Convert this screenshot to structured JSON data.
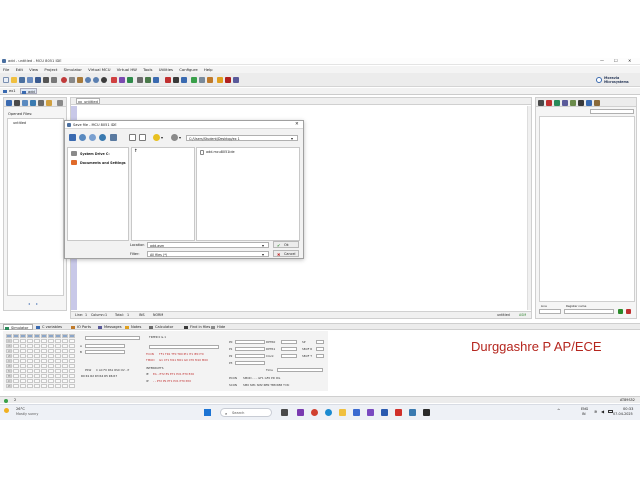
{
  "window": {
    "title": "add - untitled - MCU 8051 IDE",
    "controls": [
      "—",
      "☐",
      "✕"
    ]
  },
  "menu": [
    "File",
    "Edit",
    "View",
    "Project",
    "Simulator",
    "Virtual MCU",
    "Virtual HW",
    "Tools",
    "Utilities",
    "Configure",
    "Help"
  ],
  "brand": {
    "line1": "Moravia",
    "line2": "Microsystems"
  },
  "project_tabs": [
    "ex1",
    "add"
  ],
  "left_panel": {
    "title": "Opened Files:",
    "file": "untitled"
  },
  "editor": {
    "tab": "untitled",
    "status": {
      "line_label": "Line:",
      "line": "1",
      "column_label": "Column:",
      "column": "1",
      "total_label": "Total:",
      "total": "1",
      "ins": "INS",
      "mode": "NORM",
      "file": "untitled",
      "lang": "ASM"
    }
  },
  "dialog": {
    "title": "Save file - MCU 8051 IDE",
    "path": "C:/Users/Student/Desktop/ex 1",
    "places": [
      "System Drive C:",
      "Documents and Settings"
    ],
    "up_symbol": "↑",
    "file": "add.mcu8051ide",
    "location_label": "Location",
    "location_value": "add.asm",
    "filter_label": "Filter:",
    "filter_value": "All files (*)",
    "ok_label": "Ok",
    "cancel_label": "Cancel"
  },
  "right_panel": {
    "label1": "Line",
    "label2": "Register name"
  },
  "bottom_tabs": [
    "Simulator",
    "C variables",
    "IO Ports",
    "Messages",
    "Notes",
    "Calculator",
    "Find in files",
    "Hide"
  ],
  "simulator": {
    "timer_label": "TIMER 0 & 1",
    "interrupts_label": "INTERRUPTS",
    "psw_label": "PSW",
    "psw_bits": "C  AC  F0  RS1  RS0  OV  -  P",
    "tcon_label": "TCON",
    "tcon_bits": "TF1 TR1 TF0 TR0 IE1 IT1 IE0 IT0",
    "tmod_label": "TMOD",
    "tmod_bits": "G1 CT1 M11 M01 G0 CT0 M10 M00",
    "ie_label": "IE",
    "ie_bits": "EA  -  ET2 ES ET1 EX1 ET0 EX0",
    "ip_label": "IP",
    "ip_bits": "-  -  PT2 PS PT1 PX1 PT0 PX0",
    "regs_right": [
      "DPTR0",
      "DPTR1",
      "Clock",
      "Time"
    ],
    "sp_labels": [
      "SP",
      "SBUF R",
      "SBUF T"
    ],
    "pcon_label": "PCON",
    "pcon_bits": "SMOD  -  -  -  GF1 GF0 PD IDL",
    "scon_label": "SCON",
    "scon_bits": "SM0 SM1 SM2 REN TB8 RB8 TI RI",
    "ports": [
      "P0",
      "P1",
      "P2",
      "P3"
    ],
    "bank_regs": [
      "R0",
      "R1",
      "R2",
      "R3",
      "R4",
      "R5",
      "R6",
      "R7"
    ],
    "sfr_regs": [
      "A",
      "B"
    ]
  },
  "overlay_text": "Durggashre P AP/ECE",
  "status_bar": {
    "left": "2",
    "right": "AT89S52"
  },
  "taskbar": {
    "weather_temp": "26°C",
    "weather_desc": "Mostly sunny",
    "search_placeholder": "Search",
    "lang": "ENG",
    "region": "IN",
    "time": "00:33",
    "date": "07-04-2025"
  },
  "colors": {
    "accent": "#4a6fa0",
    "overlay": "#b5261e",
    "toolbar_bg": "#ececec",
    "taskbar": "#eef1f6"
  }
}
